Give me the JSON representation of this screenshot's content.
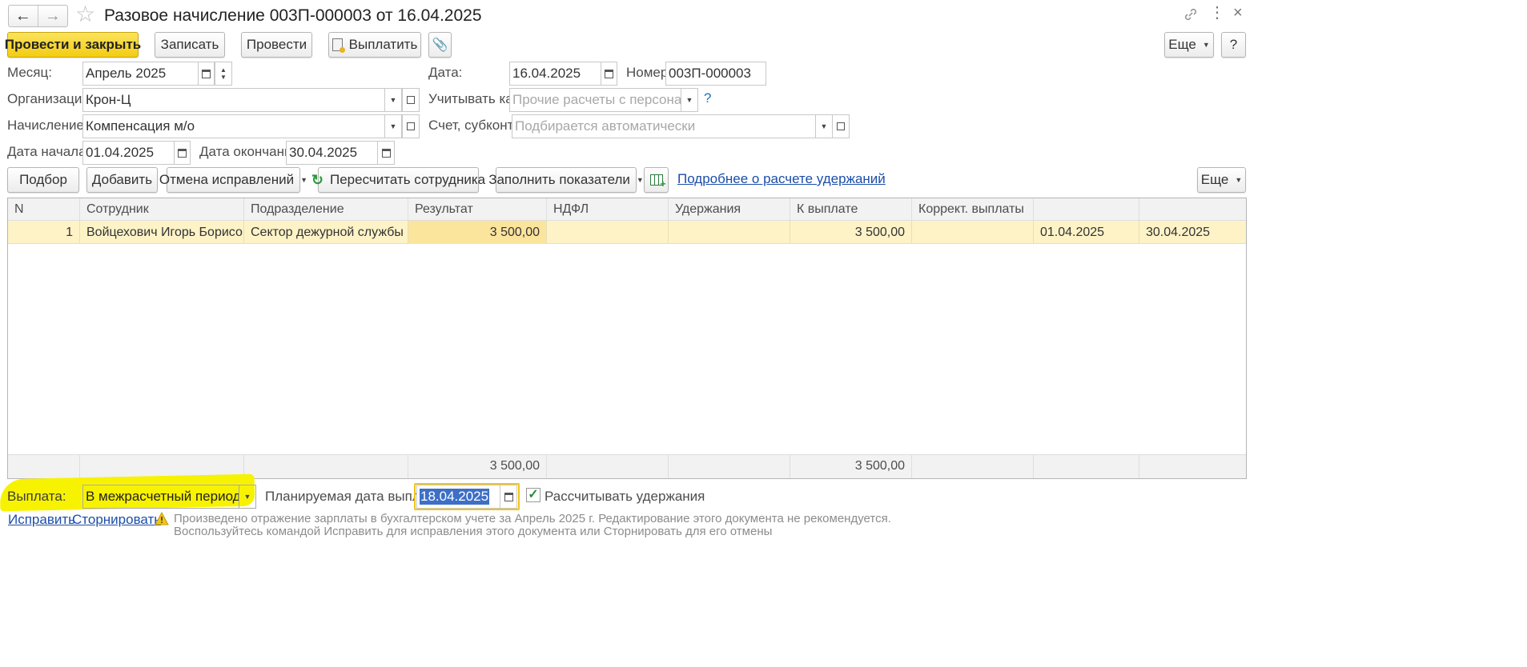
{
  "window": {
    "title": "Разовое начисление 003П-000003 от 16.04.2025"
  },
  "toolbar": {
    "post_and_close": "Провести и закрыть",
    "save": "Записать",
    "post": "Провести",
    "pay": "Выплатить",
    "more": "Еще",
    "help": "?"
  },
  "header": {
    "month_label": "Месяц:",
    "month_value": "Апрель 2025",
    "date_label": "Дата:",
    "date_value": "16.04.2025",
    "number_label": "Номер:",
    "number_value": "003П-000003",
    "org_label": "Организация:",
    "org_value": "Крон-Ц",
    "account_as_label": "Учитывать как:",
    "account_as_placeholder": "Прочие расчеты с персоналом",
    "accrual_label": "Начисление:",
    "accrual_value": "Компенсация м/о",
    "subconto_label": "Счет, субконто:",
    "subconto_placeholder": "Подбирается автоматически",
    "start_label": "Дата начала:",
    "start_value": "01.04.2025",
    "end_label": "Дата окончания:",
    "end_value": "30.04.2025",
    "help_mark": "?"
  },
  "table_toolbar": {
    "pick": "Подбор",
    "add": "Добавить",
    "cancel_corrections": "Отмена исправлений",
    "recalc": "Пересчитать сотрудника",
    "fill_indicators": "Заполнить показатели",
    "details_link": "Подробнее о расчете удержаний",
    "more": "Еще"
  },
  "table": {
    "columns": [
      "N",
      "Сотрудник",
      "Подразделение",
      "Результат",
      "НДФЛ",
      "Удержания",
      "К выплате",
      "Коррект. выплаты",
      "",
      ""
    ],
    "rows": [
      [
        "1",
        "Войцехович Игорь Борисович",
        "Сектор дежурной службы",
        "3 500,00",
        "",
        "",
        "3 500,00",
        "",
        "01.04.2025",
        "30.04.2025"
      ]
    ],
    "totals": {
      "result": "3 500,00",
      "to_pay": "3 500,00"
    }
  },
  "footer": {
    "payment_label": "Выплата:",
    "payment_value": "В межрасчетный период",
    "planned_date_label": "Планируемая дата выплаты:",
    "planned_date_value": "18.04.2025",
    "calc_deductions_label": "Рассчитывать удержания",
    "fix_link": "Исправить",
    "reverse_link": "Сторнировать",
    "warning_line1": "Произведено отражение зарплаты в бухгалтерском учете за Апрель 2025 г. Редактирование этого документа не рекомендуется.",
    "warning_line2": "Воспользуйтесь командой Исправить для исправления этого документа или Сторнировать для его отмены"
  },
  "colors": {
    "primary_button": "#f3cd12",
    "selected_row": "#fdf3c7",
    "selected_cell": "#fbe49c",
    "link": "#1b4ea8",
    "highlight_marker": "#f7f200"
  }
}
